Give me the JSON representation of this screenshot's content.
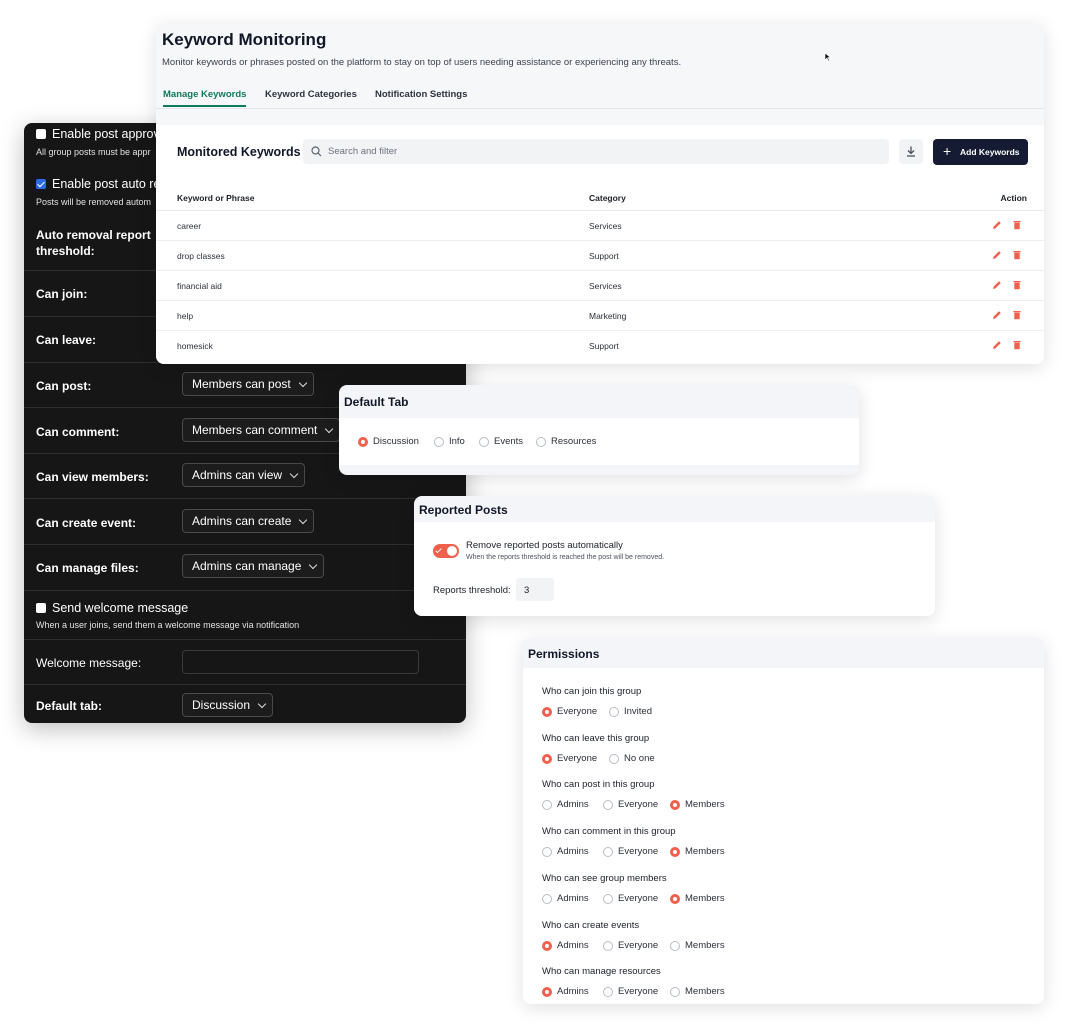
{
  "settings_panel": {
    "post_approval": {
      "label": "Enable post approval",
      "note": "All group posts must be appr",
      "checked": false
    },
    "auto_removal": {
      "label": "Enable post auto rem",
      "note": "Posts will be removed autom",
      "checked": true
    },
    "threshold_label": [
      "Auto removal report",
      "threshold:"
    ],
    "can_join_label": "Can join:",
    "can_leave_label": "Can leave:",
    "can_post": {
      "label": "Can post:",
      "value": "Members can post"
    },
    "can_comment": {
      "label": "Can comment:",
      "value": "Members can comment"
    },
    "can_view_members": {
      "label": "Can view members:",
      "value": "Admins can view"
    },
    "can_create_event": {
      "label": "Can create event:",
      "value": "Admins can create"
    },
    "can_manage_files": {
      "label": "Can manage files:",
      "value": "Admins can manage"
    },
    "welcome": {
      "label": "Send welcome message",
      "note": "When a user joins, send them a welcome message via notification",
      "checked": false
    },
    "welcome_message_label": "Welcome message:",
    "welcome_message_value": "",
    "default_tab": {
      "label": "Default tab:",
      "value": "Discussion"
    }
  },
  "keyword_monitoring": {
    "title": "Keyword Monitoring",
    "subtitle": "Monitor keywords or phrases posted on the platform to stay on top of users needing assistance or experiencing any threats.",
    "tabs": [
      "Manage Keywords",
      "Keyword Categories",
      "Notification Settings"
    ],
    "active_tab": "Manage Keywords",
    "section_title": "Monitored Keywords",
    "search_placeholder": "Search and filter",
    "add_button": "Add Keywords",
    "columns": [
      "Keyword or Phrase",
      "Category",
      "Action"
    ],
    "rows": [
      {
        "keyword": "career",
        "category": "Services"
      },
      {
        "keyword": "drop classes",
        "category": "Support"
      },
      {
        "keyword": "financial aid",
        "category": "Services"
      },
      {
        "keyword": "help",
        "category": "Marketing"
      },
      {
        "keyword": "homesick",
        "category": "Support"
      }
    ],
    "accent_color": "#0f7a56",
    "button_color": "#141b33",
    "action_color": "#f0604d"
  },
  "default_tab_card": {
    "title": "Default Tab",
    "options": [
      "Discussion",
      "Info",
      "Events",
      "Resources"
    ],
    "selected": "Discussion"
  },
  "reported_posts": {
    "title": "Reported Posts",
    "toggle_label": "Remove reported posts automatically",
    "toggle_note": "When the reports threshold is reached the post will be removed.",
    "toggle_on": true,
    "threshold_label": "Reports threshold:",
    "threshold_value": "3"
  },
  "permissions": {
    "title": "Permissions",
    "questions": [
      {
        "q": "Who can join this group",
        "options": [
          "Everyone",
          "Invited"
        ],
        "selected": "Everyone"
      },
      {
        "q": "Who can leave this group",
        "options": [
          "Everyone",
          "No one"
        ],
        "selected": "Everyone"
      },
      {
        "q": "Who can post in this group",
        "options": [
          "Admins",
          "Everyone",
          "Members"
        ],
        "selected": "Members"
      },
      {
        "q": "Who can comment in this group",
        "options": [
          "Admins",
          "Everyone",
          "Members"
        ],
        "selected": "Members"
      },
      {
        "q": "Who can see group members",
        "options": [
          "Admins",
          "Everyone",
          "Members"
        ],
        "selected": "Members"
      },
      {
        "q": "Who can create events",
        "options": [
          "Admins",
          "Everyone",
          "Members"
        ],
        "selected": "Admins"
      },
      {
        "q": "Who can manage resources",
        "options": [
          "Admins",
          "Everyone",
          "Members"
        ],
        "selected": "Admins"
      }
    ],
    "radio_color": "#f0604d"
  }
}
